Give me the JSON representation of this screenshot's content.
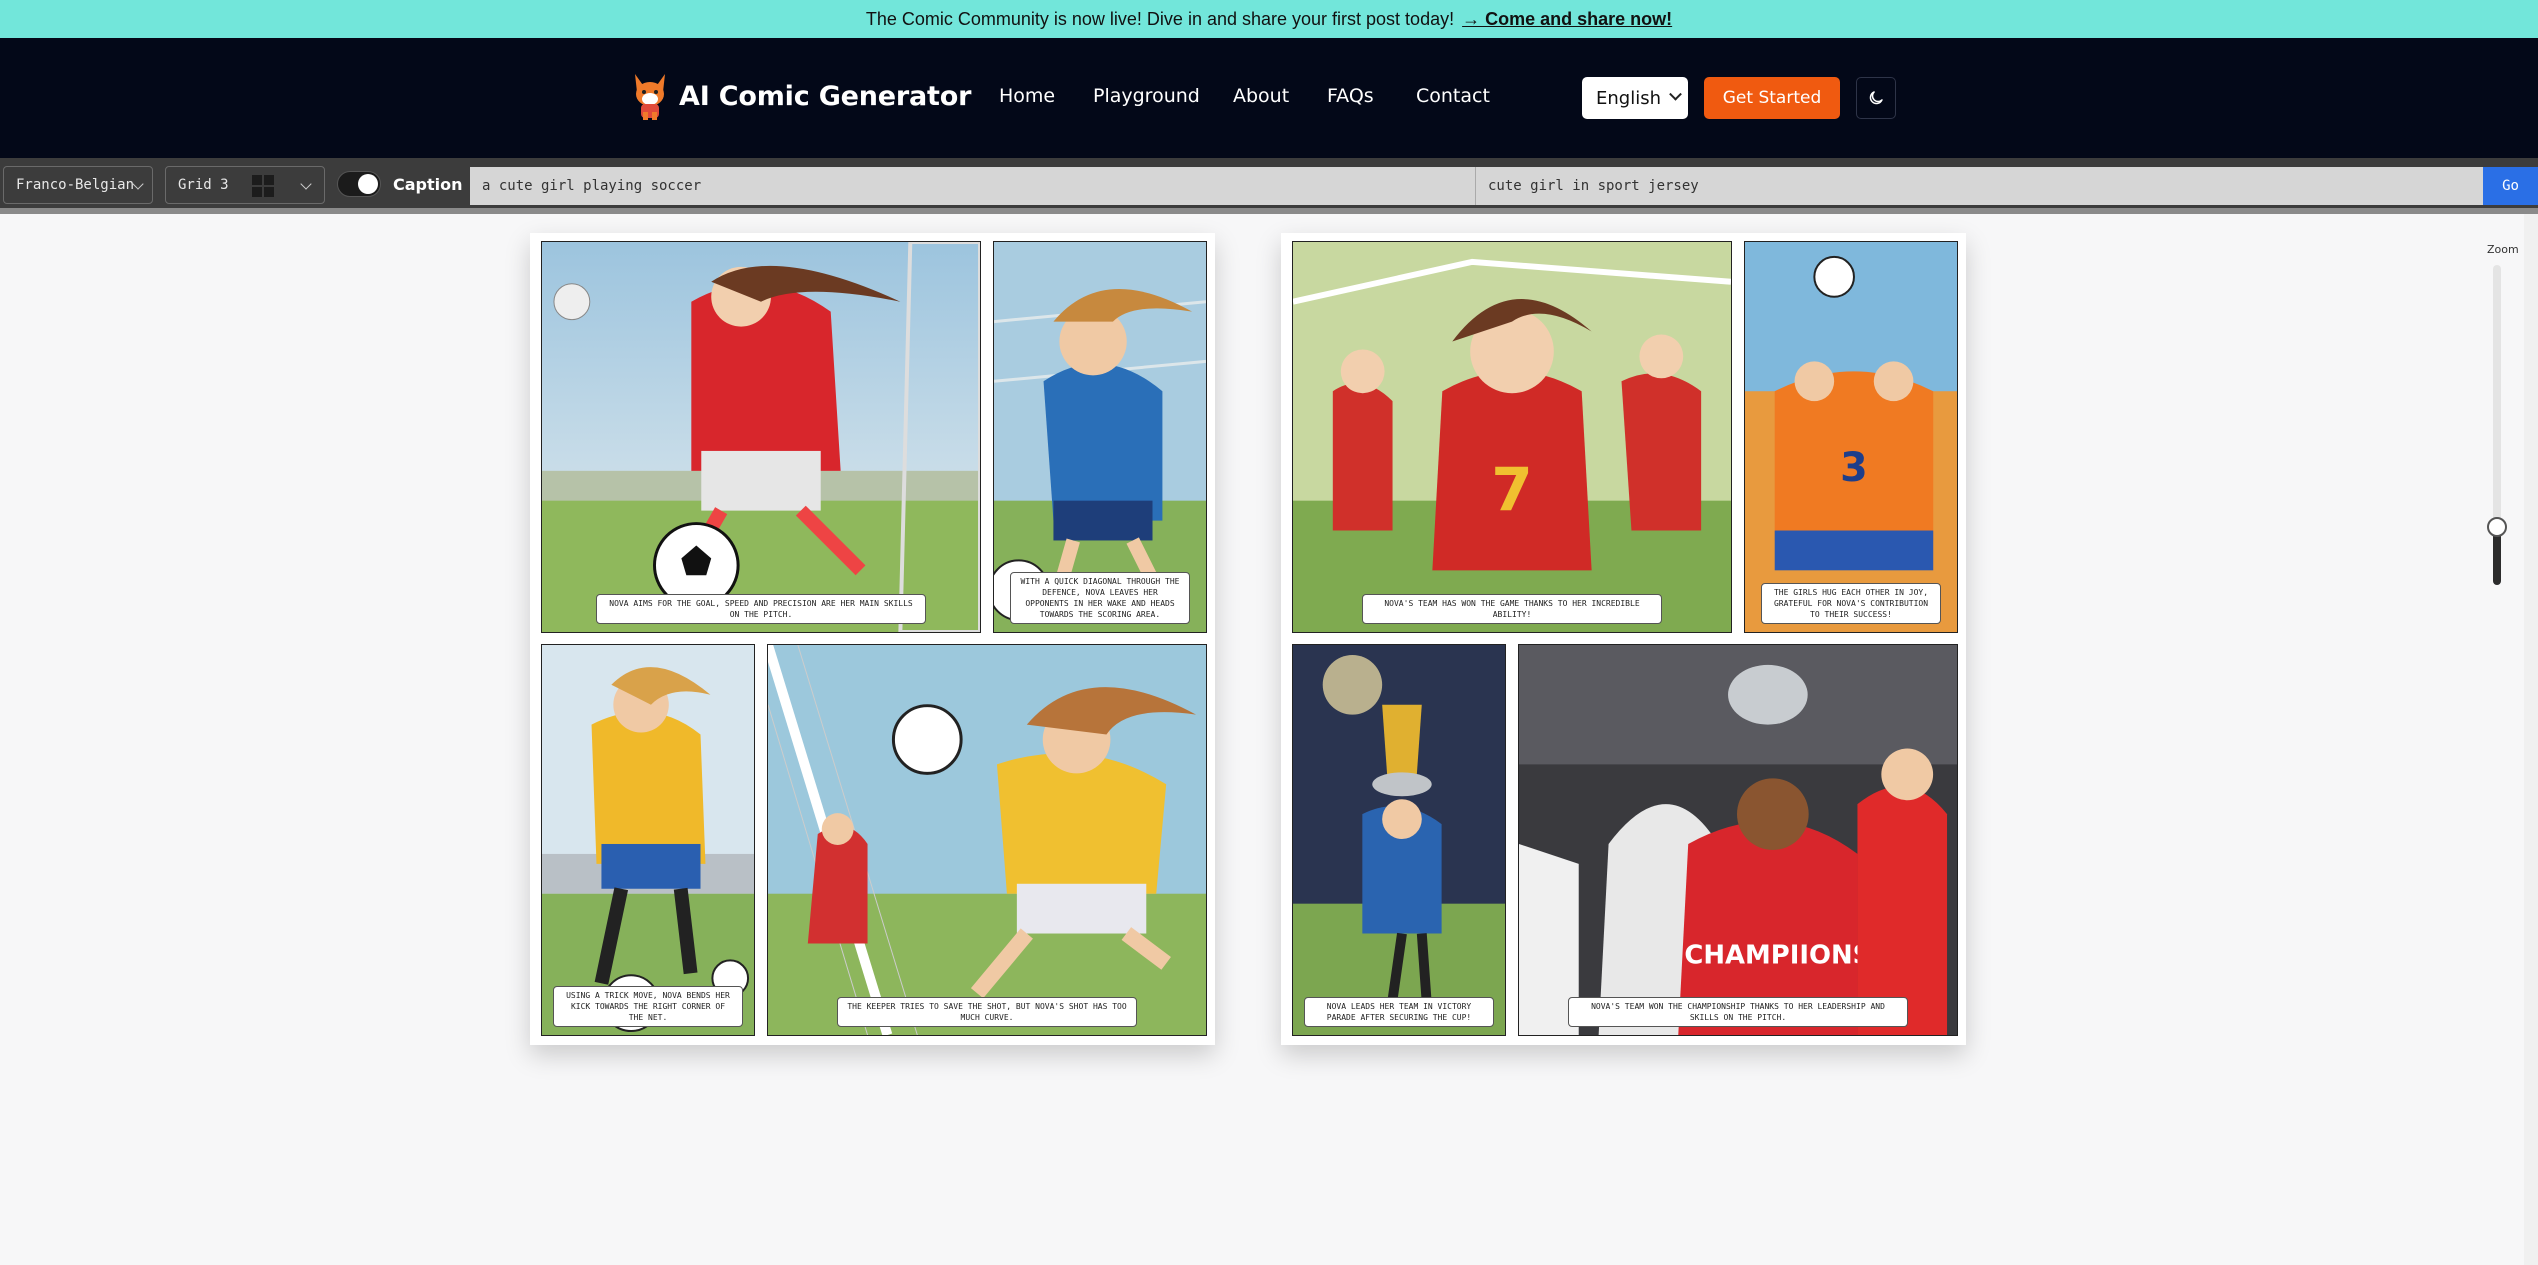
{
  "announcement": {
    "text": "The Comic Community is now live! Dive in and share your first post today!",
    "link": "→ Come and share now!"
  },
  "header": {
    "brand": "AI Comic Generator",
    "nav": [
      "Home",
      "Playground",
      "About",
      "FAQs",
      "Contact"
    ],
    "language": "English",
    "cta": "Get Started"
  },
  "toolbar": {
    "style": "Franco-Belgian",
    "grid": "Grid 3",
    "caption_label": "Caption",
    "caption_enabled": true,
    "prompt": "a cute girl playing soccer",
    "character": "cute girl in sport jersey",
    "go_label": "Go"
  },
  "pages": [
    {
      "panels": [
        {
          "caption": "Nova aims for the goal, speed and precision are her main skills on the pitch."
        },
        {
          "caption": "With a quick diagonal through the defence, Nova leaves her opponents in her wake and heads towards the scoring area."
        },
        {
          "caption": "Using a trick move, Nova bends her kick towards the right corner of the net."
        },
        {
          "caption": "The keeper tries to save the shot, but Nova's shot has too much curve."
        }
      ]
    },
    {
      "panels": [
        {
          "caption": "Nova's team has won the game thanks to her incredible ability!"
        },
        {
          "caption": "The girls hug each other in joy, grateful for Nova's contribution to their success!"
        },
        {
          "caption": "Nova leads her team in victory parade after securing the cup!"
        },
        {
          "caption": "Nova's team won the championship thanks to her leadership and skills on the pitch."
        }
      ]
    }
  ],
  "zoom": {
    "label": "Zoom",
    "level": 0.18
  }
}
